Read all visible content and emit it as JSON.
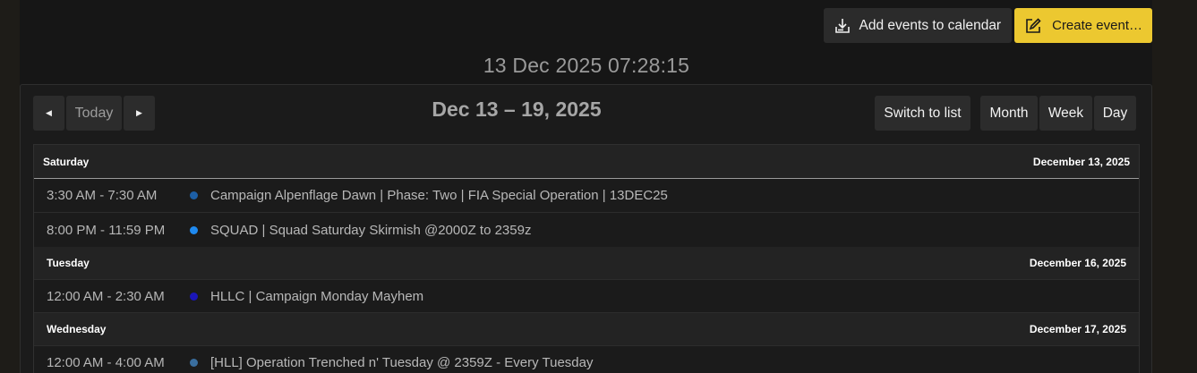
{
  "header": {
    "add_events_label": "Add events to calendar",
    "create_event_label": "Create event…"
  },
  "clock": "13 Dec 2025 07:28:15",
  "toolbar": {
    "today_label": "Today",
    "range_title": "Dec 13 – 19, 2025",
    "switch_label": "Switch to list",
    "views": [
      "Month",
      "Week",
      "Day"
    ]
  },
  "days": [
    {
      "name": "Saturday",
      "date": "December 13, 2025",
      "events": [
        {
          "time": "3:30 AM - 7:30 AM",
          "title": "Campaign Alpenflage Dawn | Phase: Two | FIA Special Operation | 13DEC25",
          "color": "#1d5fa6"
        },
        {
          "time": "8:00 PM - 11:59 PM",
          "title": "SQUAD | Squad Saturday Skirmish @2000Z to 2359z",
          "color": "#1f8af0"
        }
      ]
    },
    {
      "name": "Tuesday",
      "date": "December 16, 2025",
      "events": [
        {
          "time": "12:00 AM - 2:30 AM",
          "title": "HLLC | Campaign Monday Mayhem",
          "color": "#1b16b8"
        }
      ]
    },
    {
      "name": "Wednesday",
      "date": "December 17, 2025",
      "events": [
        {
          "time": "12:00 AM - 4:00 AM",
          "title": "[HLL] Operation Trenched n' Tuesday @ 2359Z - Every Tuesday",
          "color": "#3a6e9e"
        }
      ]
    }
  ]
}
